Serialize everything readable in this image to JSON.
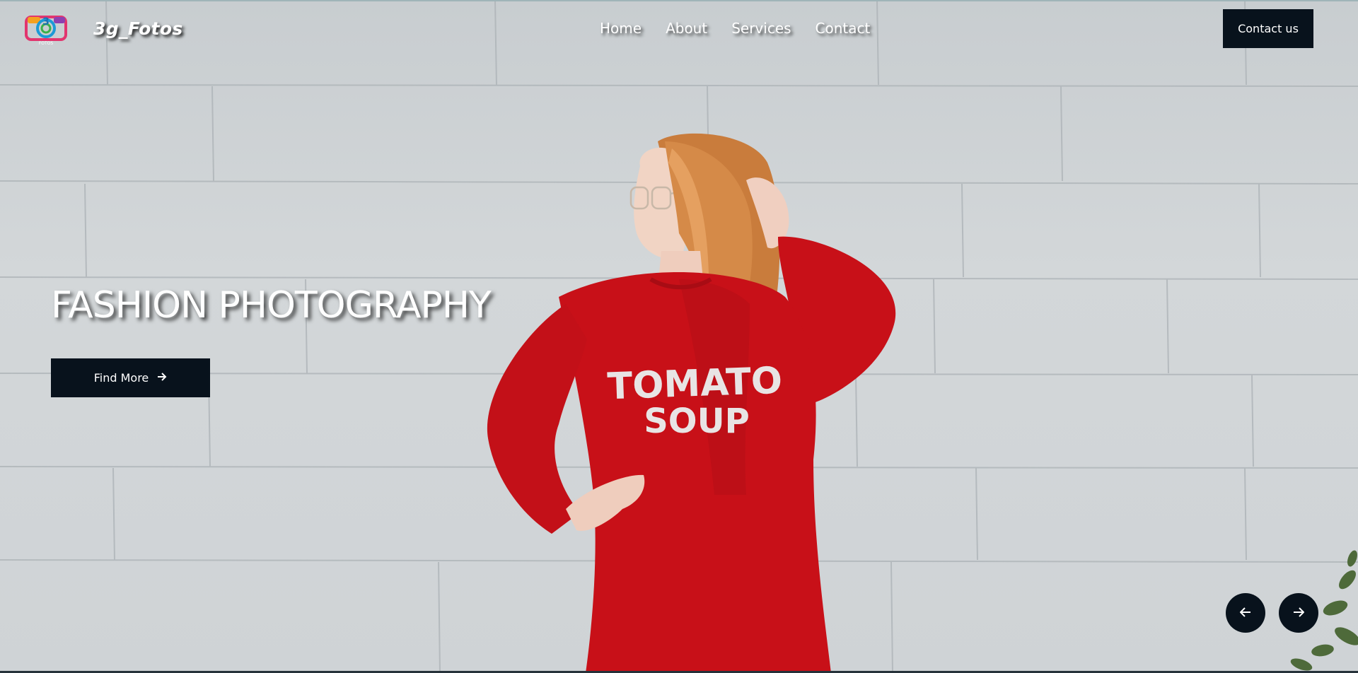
{
  "brand": {
    "name": "3g_Fotos",
    "logo_icon": "camera-3g-logo-icon"
  },
  "nav": {
    "items": [
      {
        "label": "Home"
      },
      {
        "label": "About"
      },
      {
        "label": "Services"
      },
      {
        "label": "Contact"
      }
    ]
  },
  "header": {
    "cta_label": "Contact us"
  },
  "hero": {
    "title": "FASHION PHOTOGRAPHY",
    "button_label": "Find More",
    "button_icon": "arrow-right-icon",
    "shirt_line1": "TOMATO",
    "shirt_line2": "SOUP"
  },
  "slider": {
    "prev_icon": "arrow-left-icon",
    "next_icon": "arrow-right-icon"
  },
  "colors": {
    "button_bg": "#08121c",
    "text": "#ffffff",
    "wall": "#cfd3d6",
    "sweater": "#c81018"
  }
}
